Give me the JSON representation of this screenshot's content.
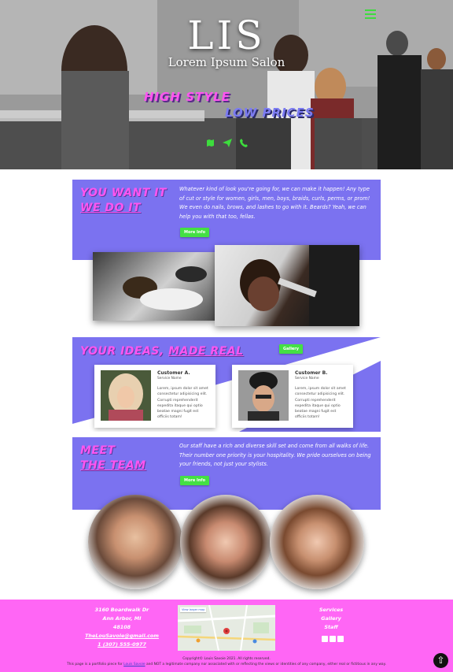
{
  "hero": {
    "title": "LIS",
    "subtitle": "Lorem Ipsum Salon",
    "slogan_1": "HIGH STYLE",
    "slogan_2": "LOW PRICES",
    "menu_icon": "hamburger-menu-icon",
    "icons": [
      "map-icon",
      "paper-plane-icon",
      "phone-icon"
    ],
    "accent_green": "#3ddc3d",
    "accent_pink": "#ff55f0",
    "accent_purple": "#7b72f0"
  },
  "want": {
    "heading_line1": "YOU WANT IT",
    "heading_line2": "WE DO IT",
    "text": "Whatever kind of look you're going for, we can make it happen! Any type of cut or style for women, girls, men, boys, braids, curls, perms, or prom! We even do nails, brows, and lashes to go with it. Beards? Yeah, we can help you with that too, fellas.",
    "button": "More Info"
  },
  "ideas": {
    "heading_part1": "YOUR IDEAS, ",
    "heading_part2": "MADE REAL",
    "button": "Gallery",
    "cards": [
      {
        "name": "Customer A.",
        "role": "Service Name",
        "desc": "Lorem, ipsum dolor sit amet consectetur adipisicing elit. Corrupti reprehenderit expedita itaque qui optio beatae magni fugit est officiis totam!"
      },
      {
        "name": "Customer B.",
        "role": "Service Name",
        "desc": "Lorem, ipsum dolor sit amet consectetur adipisicing elit. Corrupti reprehenderit expedita itaque qui optio beatae magni fugit est officiis totam!"
      }
    ]
  },
  "team": {
    "heading_line1": "MEET",
    "heading_line2": "THE TEAM",
    "text": "Our staff have a rich and diverse skill set and come from all walks of life. Their number one priority is your hospitality. We pride ourselves on being your friends, not just your stylists.",
    "button": "More Info"
  },
  "footer": {
    "address_line1": "3160 Boardwalk Dr",
    "address_line2": "Ann Arbor, MI",
    "address_line3": "48108",
    "email": "TheLouSavoie@gmail.com",
    "phone": "1 (307) 555-0977",
    "map_button": "View larger map",
    "nav": [
      "Services",
      "Gallery",
      "Staff"
    ],
    "social_icons": [
      "facebook-icon",
      "instagram-icon",
      "twitter-icon"
    ],
    "copyright": "Copyright© Louis Savoie 2021. All rights reserved.",
    "disclaimer_pre": "This page is a portfolio piece for ",
    "disclaimer_link": "Louis Savoie",
    "disclaimer_post": " and NOT a legitimate company nor associated with or reflecting the views or identities of any company, either real or fictitious in any way.",
    "scroll_top_icon": "arrow-up-circle-icon"
  }
}
